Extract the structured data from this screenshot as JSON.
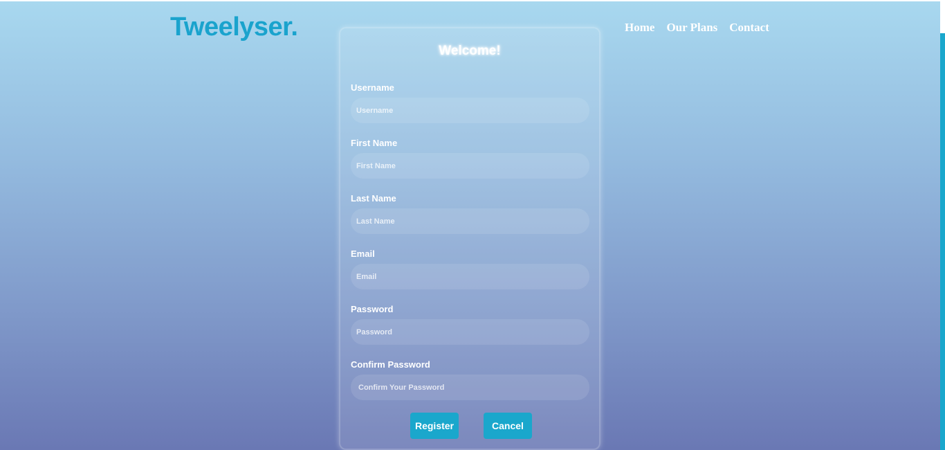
{
  "header": {
    "logo": "Tweelyser.",
    "nav": [
      {
        "label": "Home"
      },
      {
        "label": "Our Plans"
      },
      {
        "label": "Contact"
      }
    ]
  },
  "form": {
    "title": "Welcome!",
    "fields": [
      {
        "label": "Username",
        "placeholder": "Username",
        "value": ""
      },
      {
        "label": "First Name",
        "placeholder": "First Name",
        "value": ""
      },
      {
        "label": "Last Name",
        "placeholder": "Last Name",
        "value": ""
      },
      {
        "label": "Email",
        "placeholder": "Email",
        "value": ""
      },
      {
        "label": "Password",
        "placeholder": "Password",
        "value": ""
      },
      {
        "label": "Confirm Password",
        "placeholder": "Confirm Your Password",
        "value": ""
      }
    ],
    "buttons": {
      "register": "Register",
      "cancel": "Cancel"
    }
  },
  "colors": {
    "accent": "#1aa7cc",
    "logo": "#1aa3cd",
    "gradient_top": "#a8d8ef",
    "gradient_bottom": "#6a78b4"
  }
}
